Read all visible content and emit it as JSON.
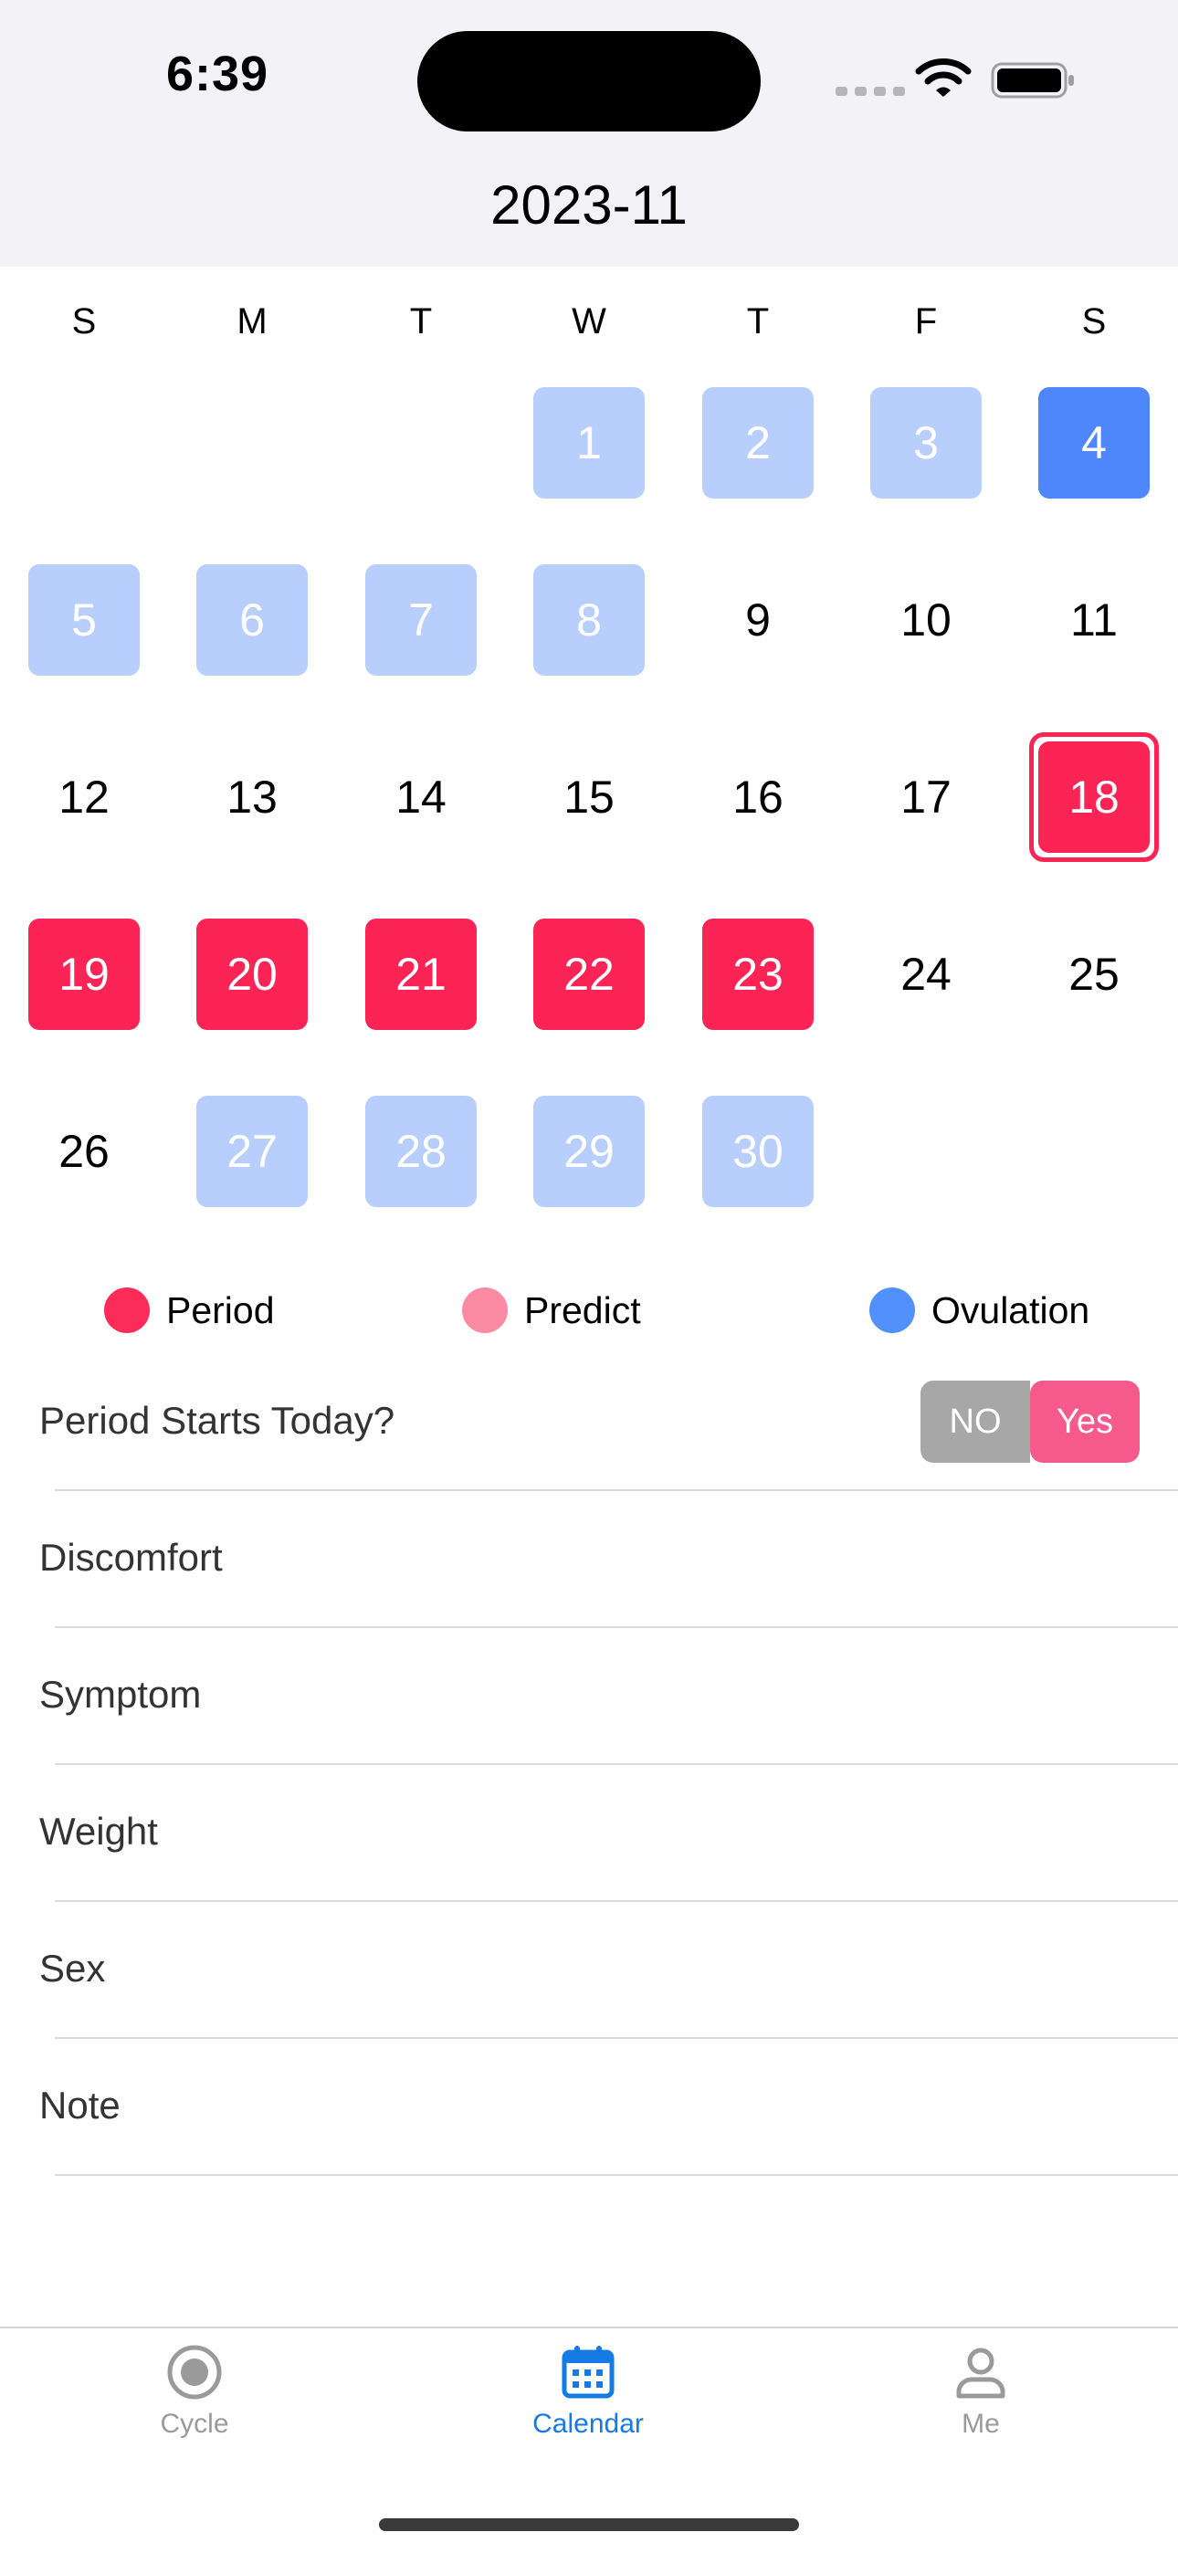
{
  "status_bar": {
    "time": "6:39"
  },
  "header": {
    "month_title": "2023-11"
  },
  "weekdays": [
    "S",
    "M",
    "T",
    "W",
    "T",
    "F",
    "S"
  ],
  "days": [
    {
      "label": "1",
      "state": "ovulation-window"
    },
    {
      "label": "2",
      "state": "ovulation-window"
    },
    {
      "label": "3",
      "state": "ovulation-window"
    },
    {
      "label": "4",
      "state": "ovulation-day"
    },
    {
      "label": "5",
      "state": "ovulation-window"
    },
    {
      "label": "6",
      "state": "ovulation-window"
    },
    {
      "label": "7",
      "state": "ovulation-window"
    },
    {
      "label": "8",
      "state": "ovulation-window"
    },
    {
      "label": "9",
      "state": "none"
    },
    {
      "label": "10",
      "state": "none"
    },
    {
      "label": "11",
      "state": "none"
    },
    {
      "label": "12",
      "state": "none"
    },
    {
      "label": "13",
      "state": "none"
    },
    {
      "label": "14",
      "state": "none"
    },
    {
      "label": "15",
      "state": "none"
    },
    {
      "label": "16",
      "state": "none"
    },
    {
      "label": "17",
      "state": "none"
    },
    {
      "label": "18",
      "state": "period-today"
    },
    {
      "label": "19",
      "state": "period"
    },
    {
      "label": "20",
      "state": "period"
    },
    {
      "label": "21",
      "state": "period"
    },
    {
      "label": "22",
      "state": "period"
    },
    {
      "label": "23",
      "state": "period"
    },
    {
      "label": "24",
      "state": "none"
    },
    {
      "label": "25",
      "state": "none"
    },
    {
      "label": "26",
      "state": "none"
    },
    {
      "label": "27",
      "state": "ovulation-window"
    },
    {
      "label": "28",
      "state": "ovulation-window"
    },
    {
      "label": "29",
      "state": "ovulation-window"
    },
    {
      "label": "30",
      "state": "ovulation-window"
    }
  ],
  "legend": [
    {
      "label": "Period",
      "color": "#fb2d58"
    },
    {
      "label": "Predict",
      "color": "#fd8aa3"
    },
    {
      "label": "Ovulation",
      "color": "#5291fb"
    }
  ],
  "period_toggle": {
    "question": "Period Starts Today?",
    "no_label": "NO",
    "yes_label": "Yes",
    "selected": "Yes"
  },
  "log_rows": [
    {
      "label": "Discomfort"
    },
    {
      "label": "Symptom"
    },
    {
      "label": "Weight"
    },
    {
      "label": "Sex"
    },
    {
      "label": "Note"
    }
  ],
  "tabs": [
    {
      "label": "Cycle",
      "icon": "target-icon",
      "active": false
    },
    {
      "label": "Calendar",
      "icon": "calendar-icon",
      "active": true
    },
    {
      "label": "Me",
      "icon": "person-icon",
      "active": false
    }
  ],
  "colors": {
    "active_tab": "#1579e6",
    "inactive_tab": "#9a9a9a",
    "period": "#fb2455",
    "ovulation_window": "#b8cffd",
    "ovulation_day": "#4d87fb"
  }
}
